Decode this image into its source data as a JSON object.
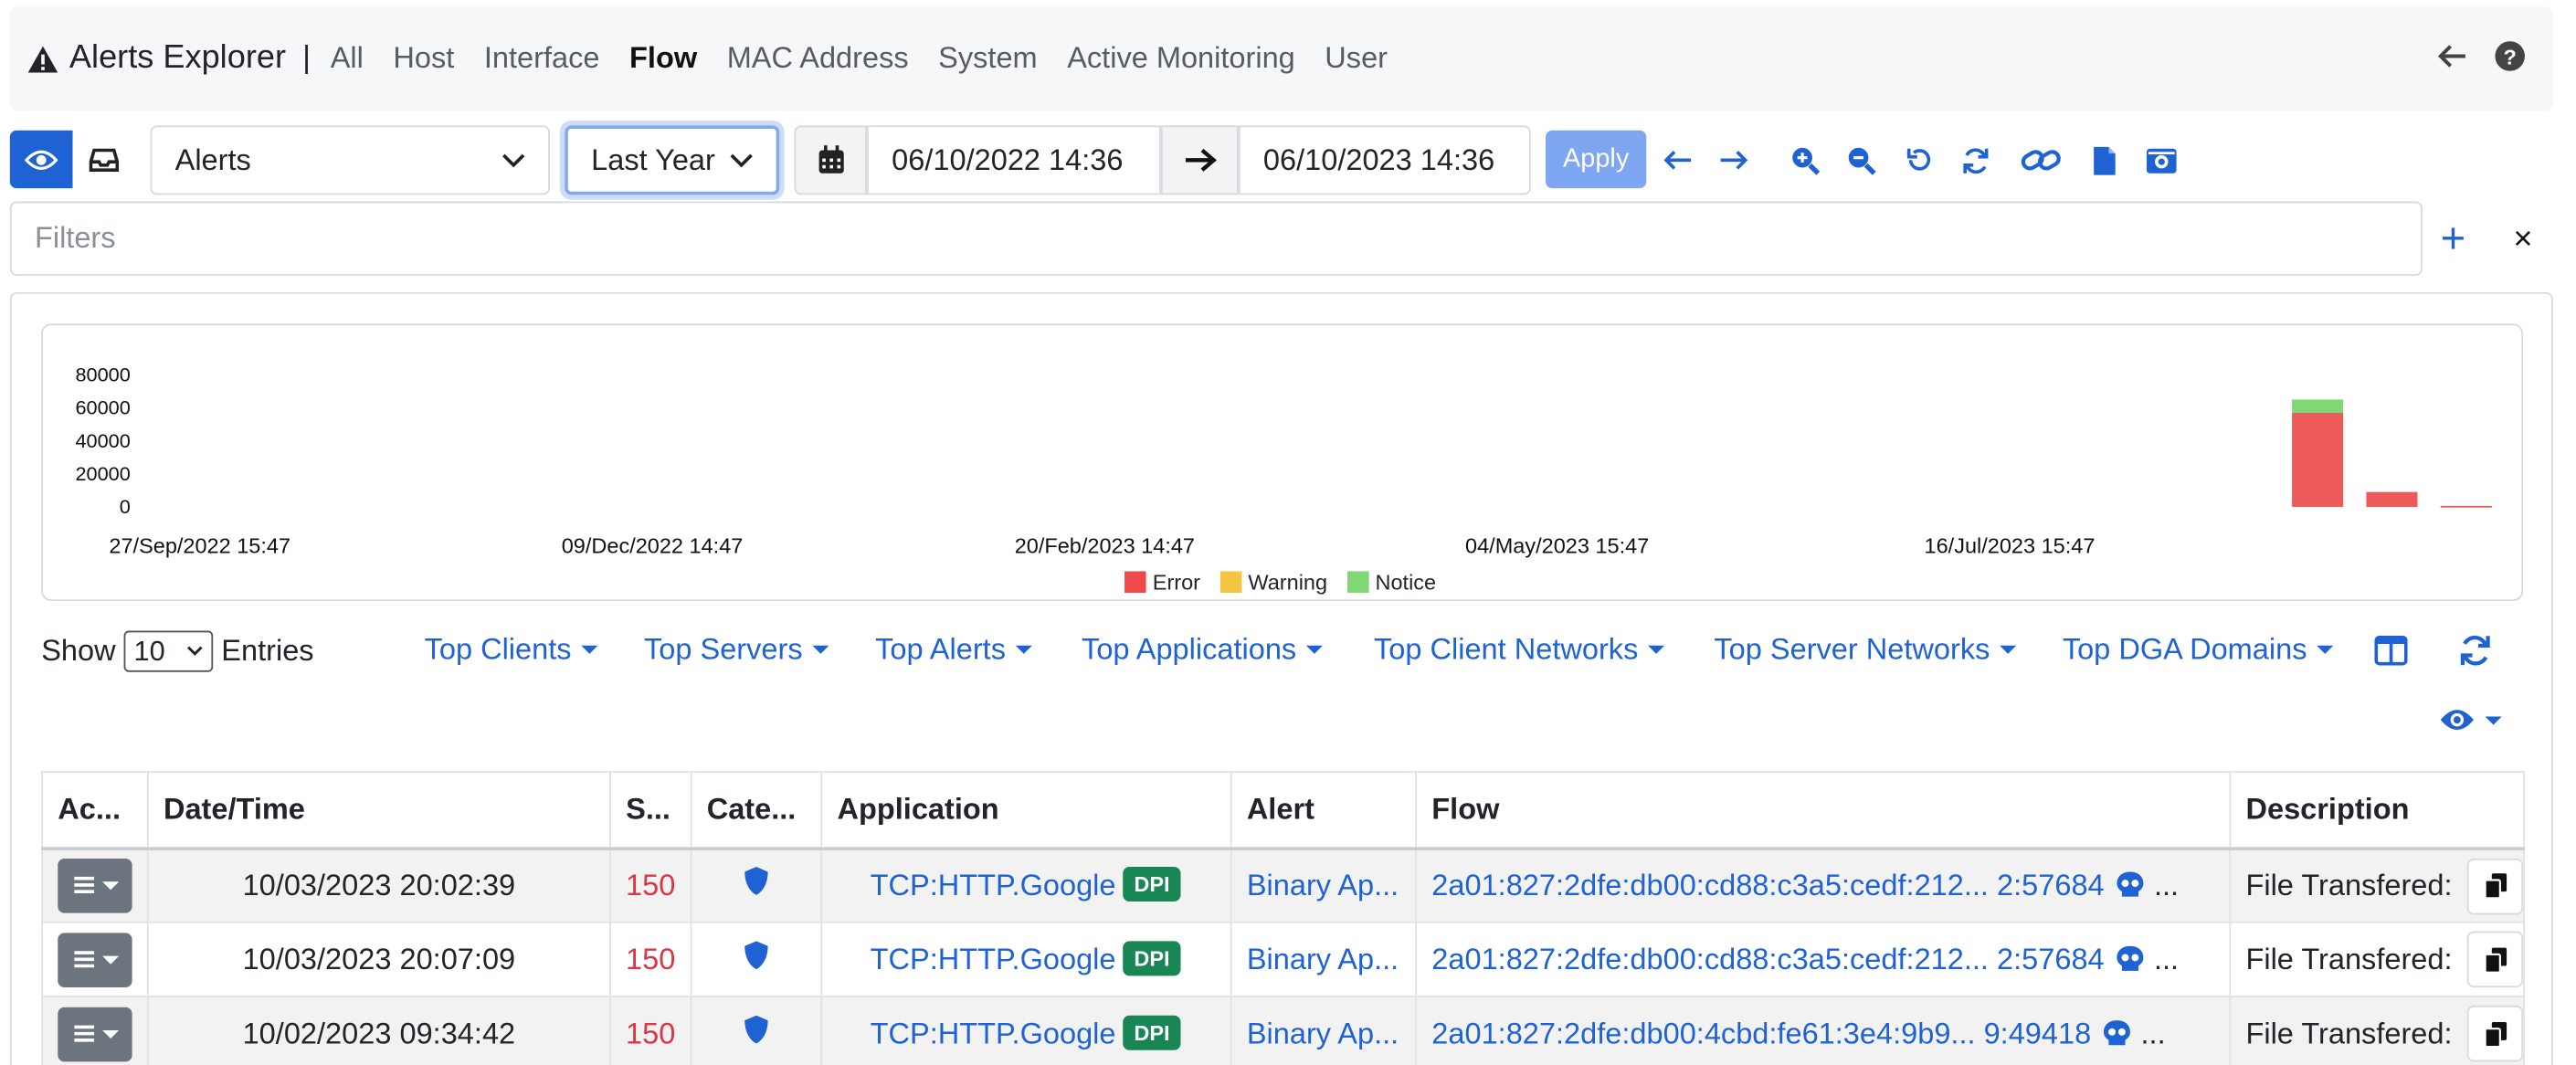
{
  "navbar": {
    "title": "Alerts Explorer",
    "separator": "|",
    "tabs": [
      {
        "label": "All"
      },
      {
        "label": "Host"
      },
      {
        "label": "Interface"
      },
      {
        "label": "Flow",
        "active": true
      },
      {
        "label": "MAC Address"
      },
      {
        "label": "System"
      },
      {
        "label": "Active Monitoring"
      },
      {
        "label": "User"
      }
    ]
  },
  "toolbar": {
    "alerts_select": "Alerts",
    "range_select": "Last Year",
    "date_from": "06/10/2022 14:36",
    "date_to": "06/10/2023 14:36",
    "apply_label": "Apply"
  },
  "filters": {
    "placeholder": "Filters",
    "add_label": "+",
    "close_label": "×"
  },
  "chart_data": {
    "type": "bar",
    "stacked": true,
    "y_ticks": [
      "80000",
      "60000",
      "40000",
      "20000",
      "0"
    ],
    "ylim": [
      0,
      80000
    ],
    "x_tick_labels": [
      "27/Sep/2022 15:47",
      "09/Dec/2022 14:47",
      "20/Feb/2023 14:47",
      "04/May/2023 15:47",
      "16/Jul/2023 15:47"
    ],
    "bars": [
      {
        "error": 57000,
        "warning": 0,
        "notice": 8000
      },
      {
        "error": 9000,
        "warning": 0,
        "notice": 0
      },
      {
        "error": 600,
        "warning": 0,
        "notice": 0
      }
    ],
    "series": [
      {
        "name": "Error",
        "color": "#ee5a5a"
      },
      {
        "name": "Warning",
        "color": "#f4c542"
      },
      {
        "name": "Notice",
        "color": "#7fd873"
      }
    ],
    "legend_position": "bottom-center"
  },
  "table_controls": {
    "show_label": "Show",
    "entries_value": "10",
    "entries_label": "Entries",
    "tops": [
      "Top Clients",
      "Top Servers",
      "Top Alerts",
      "Top Applications",
      "Top Client Networks",
      "Top Server Networks",
      "Top DGA Domains"
    ]
  },
  "table": {
    "columns": [
      "Ac...",
      "Date/Time",
      "S...",
      "Cate...",
      "Application",
      "Alert",
      "Flow",
      "Description"
    ],
    "rows": [
      {
        "datetime": "10/03/2023 20:02:39",
        "score": "150",
        "application": "TCP:HTTP.Google",
        "dpi": "DPI",
        "alert": "Binary Ap...",
        "flow": "2a01:827:2dfe:db00:cd88:c3a5:cedf:212... 2:57684",
        "flow_more": "...",
        "description": "File Transfered:"
      },
      {
        "datetime": "10/03/2023 20:07:09",
        "score": "150",
        "application": "TCP:HTTP.Google",
        "dpi": "DPI",
        "alert": "Binary Ap...",
        "flow": "2a01:827:2dfe:db00:cd88:c3a5:cedf:212... 2:57684",
        "flow_more": "...",
        "description": "File Transfered:"
      },
      {
        "datetime": "10/02/2023 09:34:42",
        "score": "150",
        "application": "TCP:HTTP.Google",
        "dpi": "DPI",
        "alert": "Binary Ap...",
        "flow": "2a01:827:2dfe:db00:4cbd:fe61:3e4:9b9... 9:49418",
        "flow_more": "...",
        "description": "File Transfered:"
      }
    ]
  }
}
